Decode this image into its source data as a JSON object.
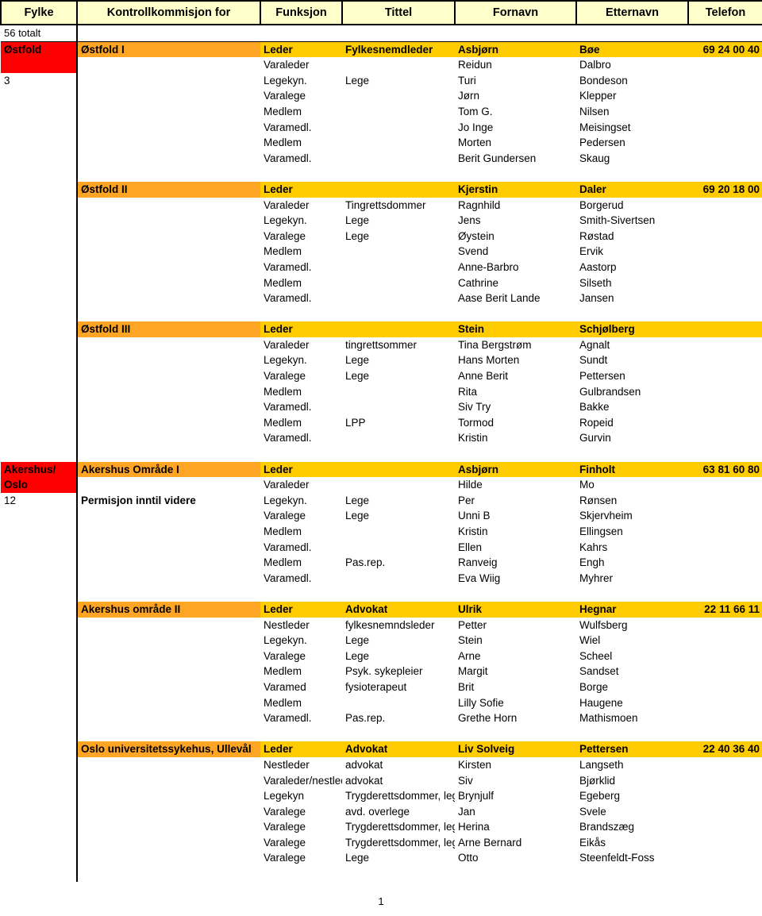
{
  "document": {
    "page_number": "1",
    "totals_label": "56 totalt"
  },
  "colors": {
    "header_bg": "#FFFFCC",
    "county_bg": "#FF0000",
    "commission_bg": "#FFA526",
    "row_band_bg": "#FFCC00",
    "border": "#000000",
    "text": "#000000"
  },
  "table": {
    "columns": [
      {
        "key": "fylke",
        "label": "Fylke"
      },
      {
        "key": "kk",
        "label": "Kontrollkommisjon for"
      },
      {
        "key": "funksjon",
        "label": "Funksjon"
      },
      {
        "key": "tittel",
        "label": "Tittel"
      },
      {
        "key": "fornavn",
        "label": "Fornavn"
      },
      {
        "key": "etternavn",
        "label": "Etternavn"
      },
      {
        "key": "telefon",
        "label": "Telefon"
      }
    ]
  },
  "counties": [
    {
      "name": "Østfold",
      "count": "3",
      "blocks": [
        {
          "commission": "Østfold I",
          "header": {
            "funksjon": "Leder",
            "tittel": "Fylkesnemdleder",
            "fornavn": "Asbjørn",
            "etternavn": "Bøe",
            "telefon": "69 24 00 40"
          },
          "members": [
            {
              "funksjon": "Varaleder",
              "tittel": "",
              "fornavn": "Reidun",
              "etternavn": "Dalbro"
            },
            {
              "funksjon": "Legekyn.",
              "tittel": "Lege",
              "fornavn": "Turi",
              "etternavn": "Bondeson"
            },
            {
              "funksjon": "Varalege",
              "tittel": "",
              "fornavn": "Jørn",
              "etternavn": "Klepper"
            },
            {
              "funksjon": "Medlem",
              "tittel": "",
              "fornavn": "Tom G.",
              "etternavn": "Nilsen"
            },
            {
              "funksjon": "Varamedl.",
              "tittel": "",
              "fornavn": "Jo Inge",
              "etternavn": "Meisingset"
            },
            {
              "funksjon": "Medlem",
              "tittel": "",
              "fornavn": "Morten",
              "etternavn": "Pedersen"
            },
            {
              "funksjon": "Varamedl.",
              "tittel": "",
              "fornavn": "Berit Gundersen",
              "etternavn": "Skaug"
            }
          ]
        },
        {
          "commission": "Østfold II",
          "header": {
            "funksjon": "Leder",
            "tittel": "",
            "fornavn": "Kjerstin",
            "etternavn": "Daler",
            "telefon": "69 20 18 00"
          },
          "members": [
            {
              "funksjon": "Varaleder",
              "tittel": "Tingrettsdommer",
              "fornavn": "Ragnhild",
              "etternavn": "Borgerud"
            },
            {
              "funksjon": "Legekyn.",
              "tittel": "Lege",
              "fornavn": "Jens",
              "etternavn": "Smith-Sivertsen"
            },
            {
              "funksjon": "Varalege",
              "tittel": "Lege",
              "fornavn": "Øystein",
              "etternavn": "Røstad"
            },
            {
              "funksjon": "Medlem",
              "tittel": "",
              "fornavn": "Svend",
              "etternavn": "Ervik"
            },
            {
              "funksjon": "Varamedl.",
              "tittel": "",
              "fornavn": "Anne-Barbro",
              "etternavn": "Aastorp"
            },
            {
              "funksjon": "Medlem",
              "tittel": "",
              "fornavn": "Cathrine",
              "etternavn": "Silseth"
            },
            {
              "funksjon": "Varamedl.",
              "tittel": "",
              "fornavn": "Aase Berit Lande",
              "etternavn": "Jansen"
            }
          ]
        },
        {
          "commission": "Østfold III",
          "header": {
            "funksjon": "Leder",
            "tittel": "",
            "fornavn": "Stein",
            "etternavn": "Schjølberg",
            "telefon": ""
          },
          "members": [
            {
              "funksjon": "Varaleder",
              "tittel": "tingrettsommer",
              "fornavn": "Tina Bergstrøm",
              "etternavn": "Agnalt"
            },
            {
              "funksjon": "Legekyn.",
              "tittel": "Lege",
              "fornavn": "Hans Morten",
              "etternavn": "Sundt"
            },
            {
              "funksjon": "Varalege",
              "tittel": "Lege",
              "fornavn": "Anne Berit",
              "etternavn": "Pettersen"
            },
            {
              "funksjon": "Medlem",
              "tittel": "",
              "fornavn": "Rita",
              "etternavn": "Gulbrandsen"
            },
            {
              "funksjon": "Varamedl.",
              "tittel": "",
              "fornavn": "Siv Try",
              "etternavn": "Bakke"
            },
            {
              "funksjon": "Medlem",
              "tittel": "LPP",
              "fornavn": "Tormod",
              "etternavn": "Ropeid"
            },
            {
              "funksjon": "Varamedl.",
              "tittel": "",
              "fornavn": "Kristin",
              "etternavn": "Gurvin"
            }
          ]
        }
      ]
    },
    {
      "name": "Akershus/ Oslo",
      "count": "12",
      "blocks": [
        {
          "commission": "Akershus Område I",
          "note": "Permisjon inntil videre",
          "header": {
            "funksjon": "Leder",
            "tittel": "",
            "fornavn": "Asbjørn",
            "etternavn": "Finholt",
            "telefon": "63 81 60 80"
          },
          "members": [
            {
              "funksjon": "Varaleder",
              "tittel": "",
              "fornavn": "Hilde",
              "etternavn": "Mo"
            },
            {
              "funksjon": "Legekyn.",
              "tittel": "Lege",
              "fornavn": "Per",
              "etternavn": "Rønsen"
            },
            {
              "funksjon": "Varalege",
              "tittel": "Lege",
              "fornavn": "Unni B",
              "etternavn": "Skjervheim"
            },
            {
              "funksjon": "Medlem",
              "tittel": "",
              "fornavn": "Kristin",
              "etternavn": "Ellingsen"
            },
            {
              "funksjon": "Varamedl.",
              "tittel": "",
              "fornavn": "Ellen",
              "etternavn": "Kahrs"
            },
            {
              "funksjon": "Medlem",
              "tittel": "Pas.rep.",
              "fornavn": "Ranveig",
              "etternavn": "Engh"
            },
            {
              "funksjon": "Varamedl.",
              "tittel": "",
              "fornavn": "Eva Wiig",
              "etternavn": "Myhrer"
            }
          ]
        },
        {
          "commission": "Akershus område II",
          "header": {
            "funksjon": "Leder",
            "tittel": "Advokat",
            "fornavn": "Ulrik",
            "etternavn": "Hegnar",
            "telefon": "22 11 66 11"
          },
          "members": [
            {
              "funksjon": "Nestleder",
              "tittel": "fylkesnemndsleder",
              "fornavn": "Petter",
              "etternavn": "Wulfsberg"
            },
            {
              "funksjon": "Legekyn.",
              "tittel": "Lege",
              "fornavn": "Stein",
              "etternavn": "Wiel"
            },
            {
              "funksjon": "Varalege",
              "tittel": "Lege",
              "fornavn": "Arne",
              "etternavn": "Scheel"
            },
            {
              "funksjon": "Medlem",
              "tittel": "Psyk. sykepleier",
              "fornavn": "Margit",
              "etternavn": "Sandset"
            },
            {
              "funksjon": "Varamed",
              "tittel": "fysioterapeut",
              "fornavn": "Brit",
              "etternavn": "Borge"
            },
            {
              "funksjon": "Medlem",
              "tittel": "",
              "fornavn": "Lilly Sofie",
              "etternavn": "Haugene"
            },
            {
              "funksjon": "Varamedl.",
              "tittel": "Pas.rep.",
              "fornavn": "Grethe Horn",
              "etternavn": "Mathismoen"
            }
          ]
        },
        {
          "commission": "Oslo universitetssykehus, Ullevål",
          "header": {
            "funksjon": "Leder",
            "tittel": "Advokat",
            "fornavn": "Liv Solveig",
            "etternavn": "Pettersen",
            "telefon": "22 40 36 40"
          },
          "members": [
            {
              "funksjon": "Nestleder",
              "tittel": "advokat",
              "fornavn": "Kirsten",
              "etternavn": "Langseth"
            },
            {
              "funksjon": "Varaleder/nestleder",
              "tittel": "advokat",
              "fornavn": "Siv",
              "etternavn": "Bjørklid"
            },
            {
              "funksjon": "Legekyn",
              "tittel": "Trygderettsdommer, lege",
              "fornavn": "Brynjulf",
              "etternavn": "Egeberg"
            },
            {
              "funksjon": "Varalege",
              "tittel": "avd. overlege",
              "fornavn": "Jan",
              "etternavn": "Svele"
            },
            {
              "funksjon": "Varalege",
              "tittel": "Trygderettsdommer, lege",
              "fornavn": "Herina",
              "etternavn": "Brandszæg"
            },
            {
              "funksjon": "Varalege",
              "tittel": "Trygderettsdommer, lege",
              "fornavn": "Arne Bernard",
              "etternavn": "Eikås"
            },
            {
              "funksjon": "Varalege",
              "tittel": "Lege",
              "fornavn": "Otto",
              "etternavn": "Steenfeldt-Foss"
            }
          ]
        }
      ]
    }
  ]
}
